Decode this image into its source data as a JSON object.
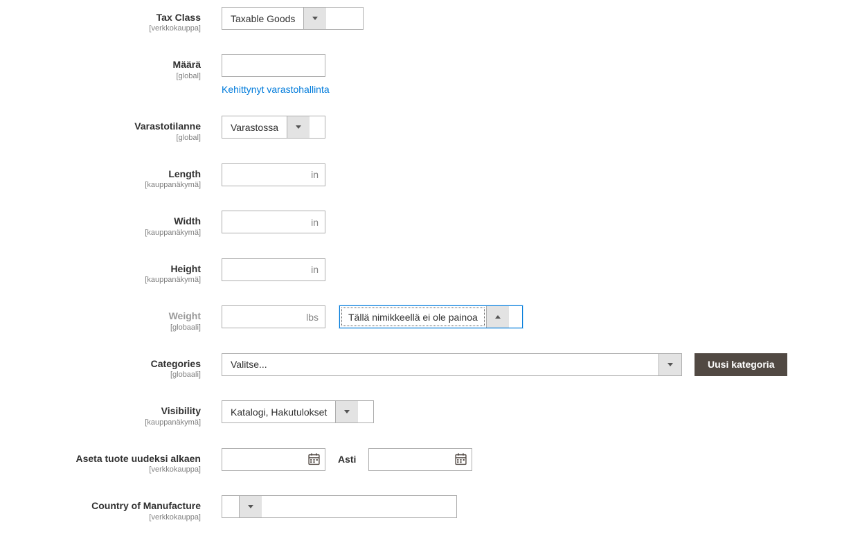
{
  "taxClass": {
    "label": "Tax Class",
    "scope": "[verkkokauppa]",
    "value": "Taxable Goods"
  },
  "qty": {
    "label": "Määrä",
    "scope": "[global]",
    "value": "",
    "advancedLink": "Kehittynyt varastohallinta"
  },
  "stockStatus": {
    "label": "Varastotilanne",
    "scope": "[global]",
    "value": "Varastossa"
  },
  "length": {
    "label": "Length",
    "scope": "[kauppanäkymä]",
    "unit": "in",
    "value": ""
  },
  "width": {
    "label": "Width",
    "scope": "[kauppanäkymä]",
    "unit": "in",
    "value": ""
  },
  "height": {
    "label": "Height",
    "scope": "[kauppanäkymä]",
    "unit": "in",
    "value": ""
  },
  "weight": {
    "label": "Weight",
    "scope": "[globaali]",
    "unit": "lbs",
    "value": "",
    "hasWeight": "Tällä nimikkeellä ei ole painoa"
  },
  "categories": {
    "label": "Categories",
    "scope": "[globaali]",
    "placeholder": "Valitse...",
    "newBtn": "Uusi kategoria"
  },
  "visibility": {
    "label": "Visibility",
    "scope": "[kauppanäkymä]",
    "value": "Katalogi, Hakutulokset"
  },
  "newFrom": {
    "label": "Aseta tuote uudeksi alkaen",
    "scope": "[verkkokauppa]",
    "to": "Asti",
    "fromValue": "",
    "toValue": ""
  },
  "country": {
    "label": "Country of Manufacture",
    "scope": "[verkkokauppa]",
    "value": ""
  }
}
